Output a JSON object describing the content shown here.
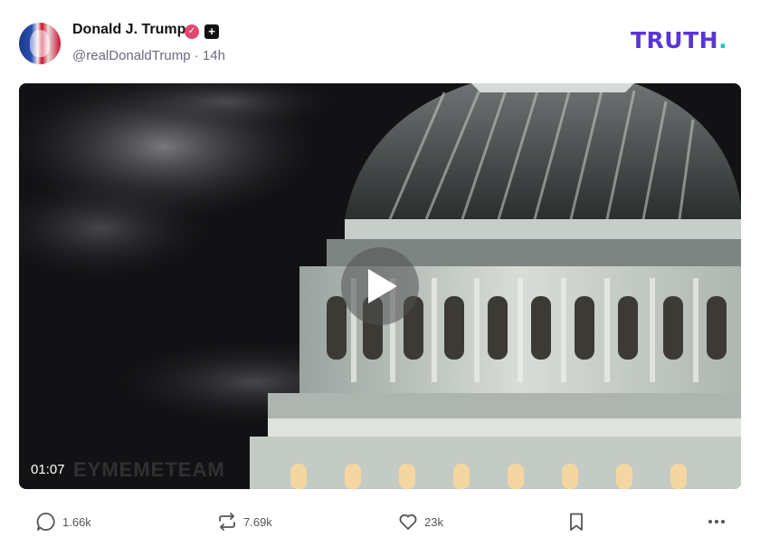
{
  "post": {
    "author_name": "Donald J. Trump",
    "author_handle": "@realDonaldTrump",
    "separator": "·",
    "time_ago": "14h",
    "verified_icon": "verified-check-icon",
    "plus_icon": "plus-badge-icon"
  },
  "brand": {
    "logo_text": "TRUTH",
    "logo_dot": ".",
    "primary_color": "#5a35d6",
    "accent_color": "#1ec7c7"
  },
  "video": {
    "duration": "01:07",
    "watermark": "EYMEMETEAM",
    "play_icon": "play-icon"
  },
  "actions": {
    "replies": "1.66k",
    "retruths": "7.69k",
    "likes": "23k",
    "icons": [
      "reply-icon",
      "retruth-icon",
      "like-icon",
      "bookmark-icon",
      "more-icon"
    ]
  }
}
